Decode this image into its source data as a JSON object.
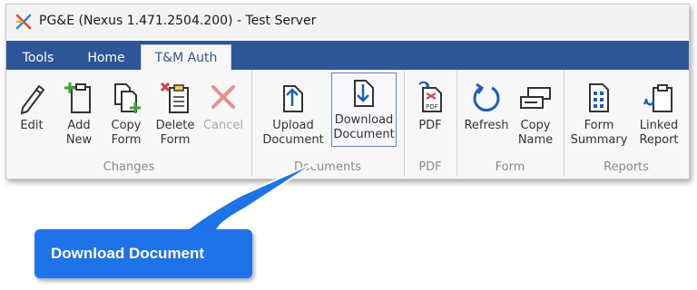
{
  "window": {
    "title": "PG&E (Nexus 1.471.2504.200) - Test Server"
  },
  "tabs": [
    {
      "label": "Tools"
    },
    {
      "label": "Home"
    },
    {
      "label": "T&M Auth"
    }
  ],
  "groups": {
    "changes": {
      "label": "Changes",
      "buttons": [
        {
          "line1": "Edit",
          "line2": ""
        },
        {
          "line1": "Add",
          "line2": "New"
        },
        {
          "line1": "Copy",
          "line2": "Form"
        },
        {
          "line1": "Delete",
          "line2": "Form"
        },
        {
          "line1": "Cancel",
          "line2": ""
        }
      ]
    },
    "documents": {
      "label": "Documents",
      "buttons": [
        {
          "line1": "Upload",
          "line2": "Document"
        },
        {
          "line1": "Download",
          "line2": "Document"
        }
      ]
    },
    "pdf": {
      "label": "PDF",
      "buttons": [
        {
          "line1": "PDF",
          "line2": "",
          "icon_text": "PDF"
        }
      ]
    },
    "form": {
      "label": "Form",
      "buttons": [
        {
          "line1": "Refresh",
          "line2": ""
        },
        {
          "line1": "Copy",
          "line2": "Name"
        }
      ]
    },
    "reports": {
      "label": "Reports",
      "buttons": [
        {
          "line1": "Form",
          "line2": "Summary"
        },
        {
          "line1": "Linked",
          "line2": "Report"
        }
      ]
    }
  },
  "callout": {
    "text": "Download Document"
  },
  "colors": {
    "accent": "#2e5597",
    "callout": "#1f73e8",
    "icon_blue": "#1a5fb4",
    "icon_red": "#d83b3b",
    "icon_green": "#3da33d"
  }
}
